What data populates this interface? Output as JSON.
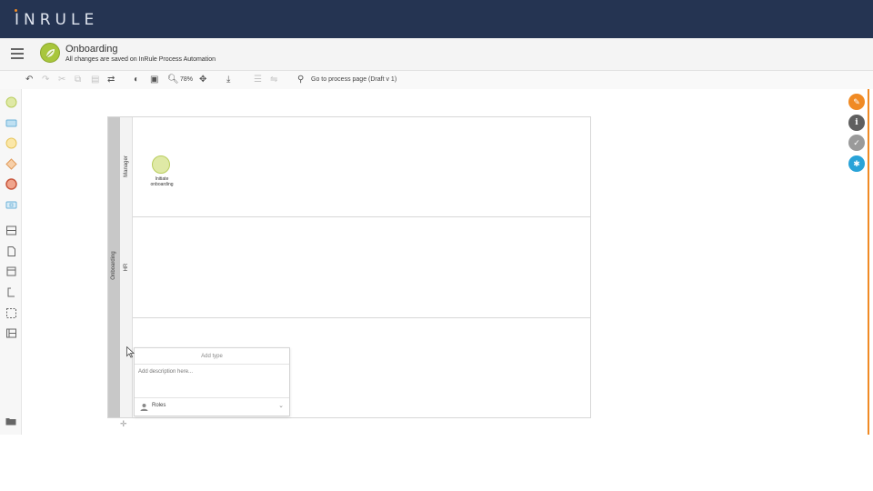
{
  "app": {
    "logo": "INRULE"
  },
  "header": {
    "title": "Onboarding",
    "subtitle": "All changes are saved on InRule Process Automation"
  },
  "toolbar": {
    "zoom": "78%",
    "goto_label": "Go to process page (Draft v 1)"
  },
  "pool": {
    "name": "Onboarding",
    "lanes": [
      {
        "name": "Manager"
      },
      {
        "name": "HR"
      },
      {
        "name": ""
      }
    ]
  },
  "start_event": {
    "label_line1": "Initiate",
    "label_line2": "onboarding"
  },
  "popup": {
    "header": "Add type",
    "description_placeholder": "Add description here...",
    "role_label": "Roles"
  },
  "colors": {
    "topbar": "#253452",
    "accent": "#f08a24",
    "start_event": "#dfe9a6",
    "info": "#29a3d8"
  }
}
